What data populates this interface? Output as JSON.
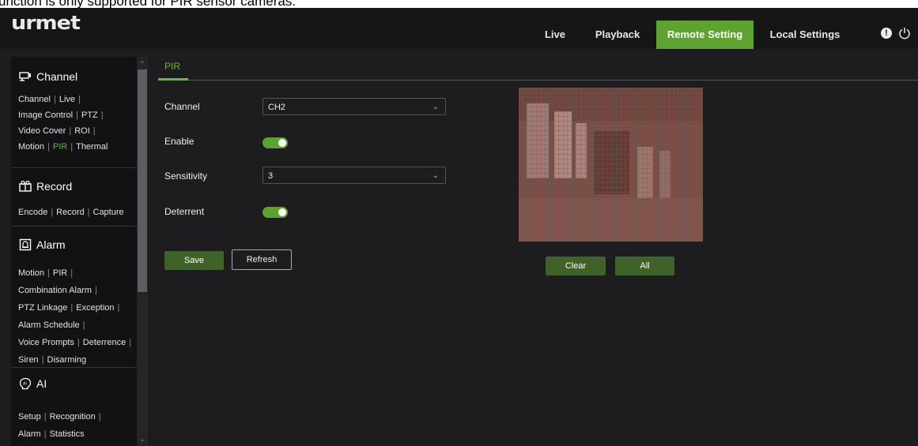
{
  "caption": "unction is only supported for PIR sensor cameras.",
  "header": {
    "logo": "urmet",
    "nav": [
      {
        "label": "Live"
      },
      {
        "label": "Playback"
      },
      {
        "label": "Remote Setting",
        "active": true
      },
      {
        "label": "Local Settings"
      }
    ],
    "alert_glyph": "!"
  },
  "sidebar": {
    "channel": {
      "title": "Channel",
      "icon": "camera-icon",
      "links": [
        "Channel",
        "Live",
        "Image Control",
        "PTZ",
        "Video Cover",
        "ROI",
        "Motion",
        "PIR",
        "Thermal"
      ],
      "active": "PIR"
    },
    "record": {
      "title": "Record",
      "icon": "record-icon",
      "links": [
        "Encode",
        "Record",
        "Capture"
      ]
    },
    "alarm": {
      "title": "Alarm",
      "icon": "alarm-icon",
      "links": [
        "Motion",
        "PIR",
        "Combination Alarm",
        "PTZ Linkage",
        "Exception",
        "Alarm Schedule",
        "Voice Prompts",
        "Deterrence",
        "Siren",
        "Disarming"
      ]
    },
    "ai": {
      "title": "AI",
      "icon": "ai-icon",
      "links": [
        "Setup",
        "Recognition",
        "Alarm",
        "Statistics"
      ]
    }
  },
  "main": {
    "tab": "PIR",
    "channel_label": "Channel",
    "channel_value": "CH2",
    "enable_label": "Enable",
    "enable_on": true,
    "sensitivity_label": "Sensitivity",
    "sensitivity_value": "3",
    "deterrent_label": "Deterrent",
    "deterrent_on": true,
    "save_label": "Save",
    "refresh_label": "Refresh",
    "clear_label": "Clear",
    "all_label": "All"
  },
  "colors": {
    "accent": "#5ea232",
    "button": "#3f6229",
    "grid": "#c0392b",
    "background": "#1d1d1f"
  }
}
